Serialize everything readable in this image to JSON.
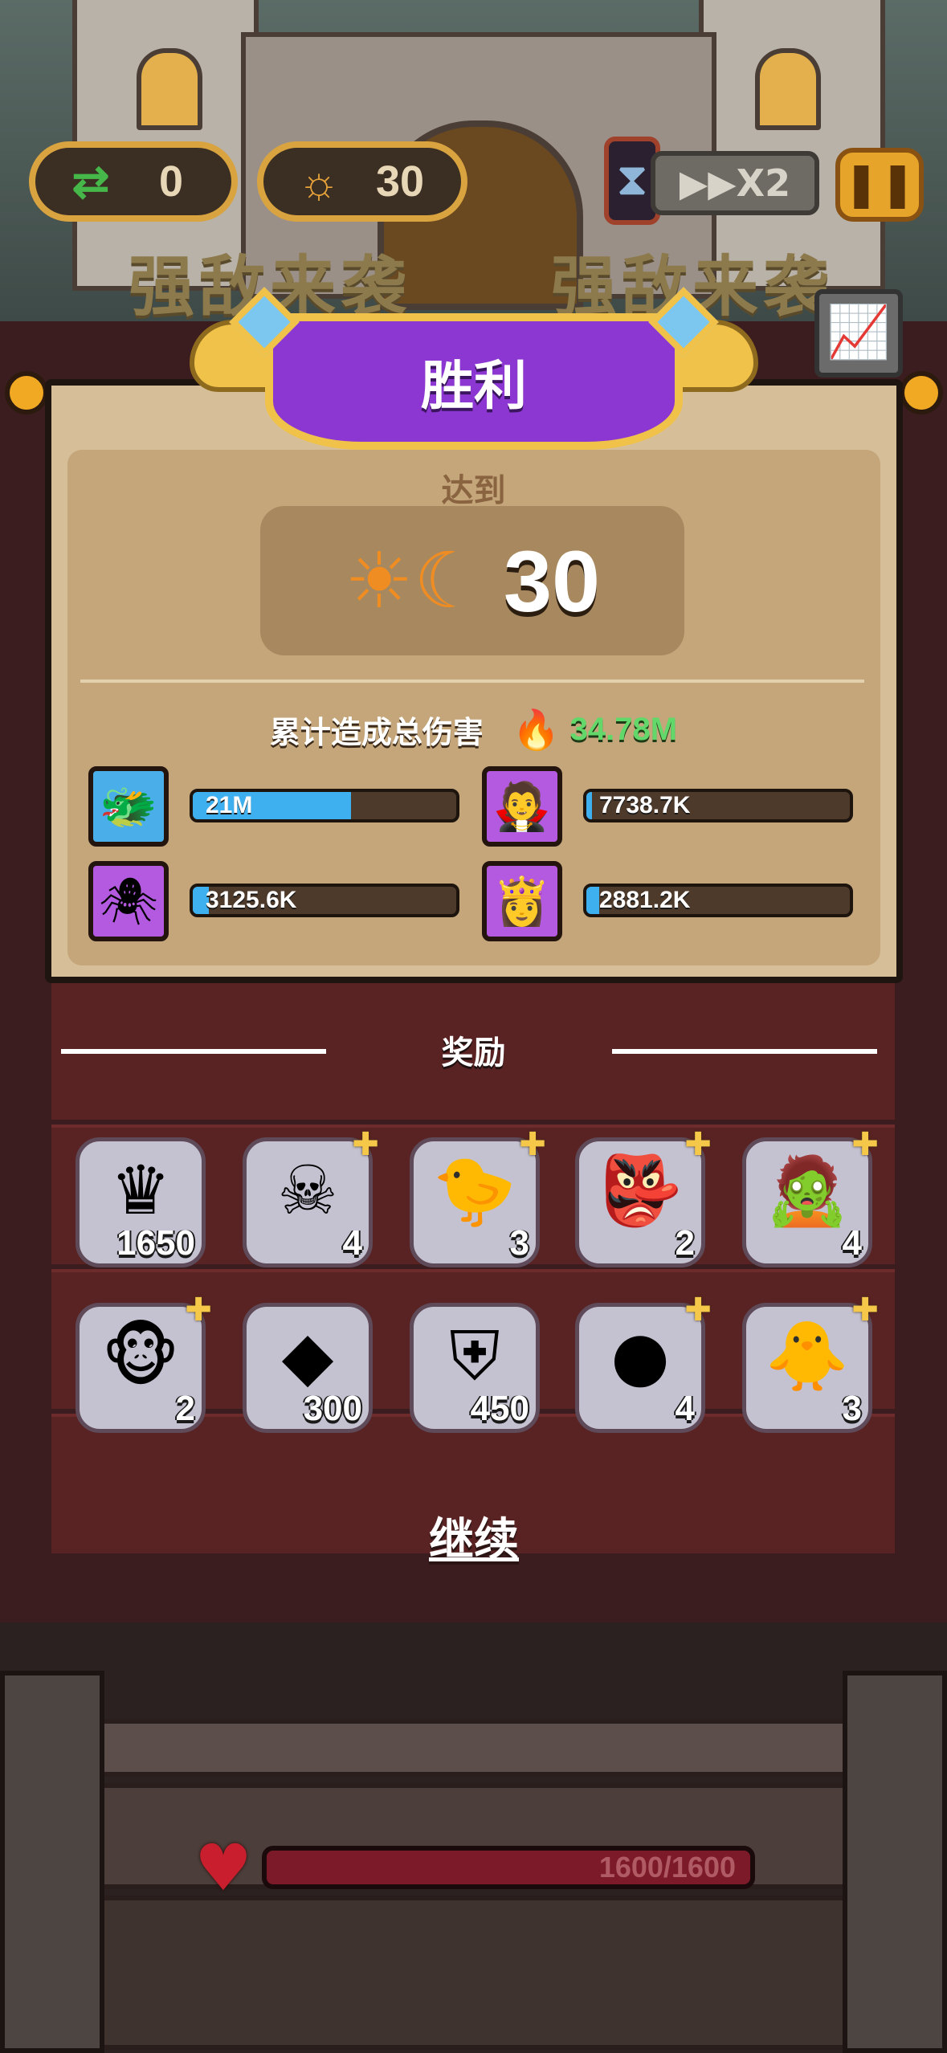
{
  "hud": {
    "swap_icon": "swap-arrows-icon",
    "swap_count": "0",
    "day_icon": "sun-moon-icon",
    "day_count": "30",
    "speed_label": "▶▶X2",
    "pause_icon": "pause-icon"
  },
  "banner": {
    "left_text": "强敌来袭",
    "right_text": "强敌来袭"
  },
  "victory": {
    "title": "胜利",
    "reached_label": "达到",
    "reached_value": "30",
    "damage_label": "累计造成总伤害",
    "damage_total": "34.78M"
  },
  "heroes": [
    {
      "name_icon": "dragon-warrior-icon",
      "damage": "21M",
      "fill": 0.6,
      "frame": "#4aaee8"
    },
    {
      "name_icon": "vampire-icon",
      "damage": "7738.7K",
      "fill": 0.02,
      "frame": "#b45ae0"
    },
    {
      "name_icon": "spider-demon-icon",
      "damage": "3125.6K",
      "fill": 0.06,
      "frame": "#b45ae0"
    },
    {
      "name_icon": "ice-queen-icon",
      "damage": "2881.2K",
      "fill": 0.05,
      "frame": "#b45ae0"
    }
  ],
  "rewards": {
    "title": "奖励",
    "items": [
      {
        "icon": "crown-coin-icon",
        "glyph": "♛",
        "qty": "1650",
        "puzzle": false
      },
      {
        "icon": "skull-mage-icon",
        "glyph": "☠",
        "qty": "4",
        "puzzle": true
      },
      {
        "icon": "hooded-bird-icon",
        "glyph": "🐤",
        "qty": "3",
        "puzzle": true
      },
      {
        "icon": "goblin-icon",
        "glyph": "👺",
        "qty": "2",
        "puzzle": true
      },
      {
        "icon": "mummy-icon",
        "glyph": "🧟",
        "qty": "4",
        "puzzle": true
      },
      {
        "icon": "monkey-icon",
        "glyph": "🐵",
        "qty": "2",
        "puzzle": true
      },
      {
        "icon": "blue-crystal-icon",
        "glyph": "◆",
        "qty": "300",
        "puzzle": false
      },
      {
        "icon": "shield-emblem-icon",
        "glyph": "⛨",
        "qty": "450",
        "puzzle": false
      },
      {
        "icon": "green-slime-icon",
        "glyph": "●",
        "qty": "4",
        "puzzle": true
      },
      {
        "icon": "yellow-chick-icon",
        "glyph": "🐥",
        "qty": "3",
        "puzzle": true
      }
    ]
  },
  "continue_label": "继续",
  "health": {
    "text": "1600/1600",
    "fill": 1.0
  },
  "colors": {
    "title_purple": "#8c37d1",
    "gold": "#f1c24a",
    "damage_green": "#62d76a",
    "bar_blue": "#3fb0ef"
  }
}
